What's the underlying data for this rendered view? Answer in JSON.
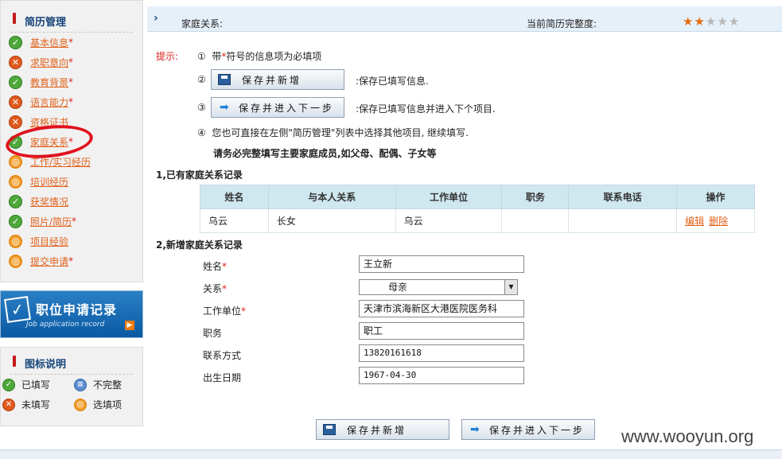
{
  "sidebar": {
    "resume_title": "简历管理",
    "items": [
      {
        "label": "基本信息",
        "required": "*",
        "status": "ok"
      },
      {
        "label": "求职意向",
        "required": "*",
        "status": "bad"
      },
      {
        "label": "教育背景",
        "required": "*",
        "status": "ok"
      },
      {
        "label": "语言能力",
        "required": "*",
        "status": "bad"
      },
      {
        "label": "资格证书",
        "required": "",
        "status": "bad"
      },
      {
        "label": "家庭关系",
        "required": "*",
        "status": "ok"
      },
      {
        "label": "工作/实习经历",
        "required": "",
        "status": "opt"
      },
      {
        "label": "培训经历",
        "required": "",
        "status": "opt"
      },
      {
        "label": "获奖情况",
        "required": "",
        "status": "ok"
      },
      {
        "label": "照片/简历",
        "required": "*",
        "status": "ok"
      },
      {
        "label": "项目经验",
        "required": "",
        "status": "opt"
      },
      {
        "label": "提交申请",
        "required": "*",
        "status": "opt"
      }
    ],
    "banner_title": "职位申请记录",
    "banner_subtitle": "Job application record",
    "legend_title": "图标说明",
    "legend": {
      "filled": "已填写",
      "incomplete": "不完整",
      "unfilled": "未填写",
      "optional": "选填项"
    }
  },
  "header": {
    "section": "家庭关系:",
    "completeness_label": "当前简历完整度:",
    "stars_filled": 2,
    "stars_total": 5
  },
  "tips": {
    "label": "提示:",
    "n1": "①",
    "t1_pre": "带",
    "t1_star": "*",
    "t1_post": "符号的信息项为必填项",
    "n2": "②",
    "t2": ":保存已填写信息.",
    "n3": "③",
    "t3": ":保存已填写信息并进入下个项目.",
    "n4": "④",
    "t4": "您也可直接在左侧\"简历管理\"列表中选择其他项目, 继续填写.",
    "bold": "请务必完整填写主要家庭成员,如父母、配偶、子女等"
  },
  "buttons": {
    "save_new": "保存并新增",
    "save_next": "保存并进入下一步"
  },
  "existing": {
    "title": "1,已有家庭关系记录",
    "headers": [
      "姓名",
      "与本人关系",
      "工作单位",
      "职务",
      "联系电话",
      "操作"
    ],
    "rows": [
      {
        "name": "乌云",
        "relation": "长女",
        "company": "乌云",
        "position": "",
        "phone": "",
        "edit": "编辑",
        "delete": "删除"
      }
    ]
  },
  "form": {
    "title": "2,新增家庭关系记录",
    "name_label": "姓名",
    "name_star": "*",
    "name_value": "王立新",
    "relation_label": "关系",
    "relation_star": "*",
    "relation_value": "母亲",
    "company_label": "工作单位",
    "company_star": "*",
    "company_value": "天津市滨海新区大港医院医务科",
    "position_label": "职务",
    "position_value": "职工",
    "contact_label": "联系方式",
    "contact_value": "13820161618",
    "birth_label": "出生日期",
    "birth_value": "1967-04-30"
  },
  "watermark": "www.wooyun.org"
}
